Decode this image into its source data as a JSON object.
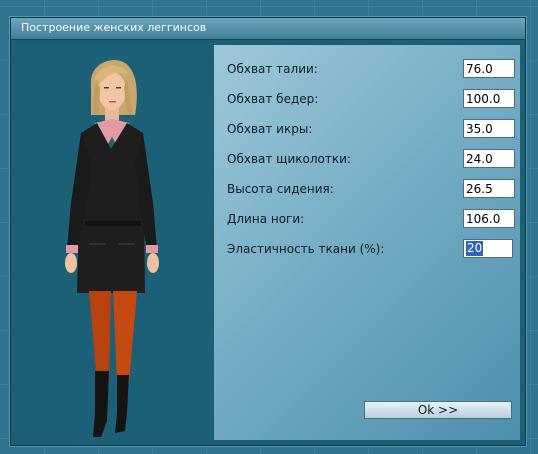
{
  "window": {
    "title": "Построение женских леггинсов"
  },
  "fields": [
    {
      "label": "Обхват талии:",
      "value": "76.0"
    },
    {
      "label": "Обхват бедер:",
      "value": "100.0"
    },
    {
      "label": "Обхват икры:",
      "value": "35.0"
    },
    {
      "label": "Обхват щиколотки:",
      "value": "24.0"
    },
    {
      "label": "Высота сидения:",
      "value": "26.5"
    },
    {
      "label": "Длина ноги:",
      "value": "106.0"
    },
    {
      "label": "Эластичность ткани (%):",
      "value": "20"
    }
  ],
  "buttons": {
    "ok_label": "Ok >>"
  },
  "colors": {
    "accent": "#3265b8",
    "panel_left": "#1b6077",
    "background": "#2f7590"
  },
  "icons": {
    "preview": "model-figure-image"
  }
}
